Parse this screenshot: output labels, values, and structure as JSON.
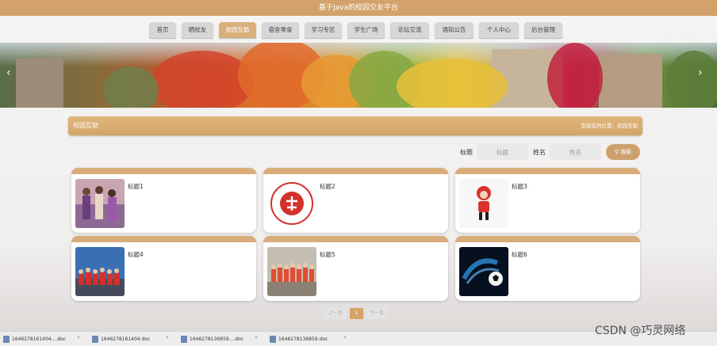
{
  "header": {
    "title": "基于Java的校园交友平台"
  },
  "nav": {
    "items": [
      {
        "label": "首页"
      },
      {
        "label": "晒校友"
      },
      {
        "label": "校园互助",
        "active": true
      },
      {
        "label": "宿舍零食"
      },
      {
        "label": "学习专区"
      },
      {
        "label": "学生广场"
      },
      {
        "label": "论坛交流"
      },
      {
        "label": "通知公告"
      },
      {
        "label": "个人中心"
      },
      {
        "label": "后台管理"
      }
    ]
  },
  "section": {
    "title": "校园互助",
    "breadcrumb": "您现在的位置：校园互助"
  },
  "search": {
    "title_label": "标题",
    "title_placeholder": "标题",
    "name_label": "姓名",
    "name_placeholder": "姓名",
    "button_label": "搜索"
  },
  "cards": [
    {
      "title": "标题1",
      "image": "people-photo"
    },
    {
      "title": "标题2",
      "image": "volunteer-logo"
    },
    {
      "title": "标题3",
      "image": "mascot"
    },
    {
      "title": "标题4",
      "image": "group-photo"
    },
    {
      "title": "标题5",
      "image": "team-photo"
    },
    {
      "title": "标题6",
      "image": "soccer-ball"
    }
  ],
  "pagination": {
    "prev": "上一页",
    "current": "1",
    "next": "下一页"
  },
  "downloads": [
    {
      "name": "1646278161404....doc"
    },
    {
      "name": "1646278161404.doc"
    },
    {
      "name": "1646278136859....doc"
    },
    {
      "name": "1646278136859.doc"
    }
  ],
  "watermark": "CSDN @巧灵网络",
  "colors": {
    "accent": "#d3a26a",
    "active_tab": "#d9b07c",
    "button": "#cda16e"
  }
}
